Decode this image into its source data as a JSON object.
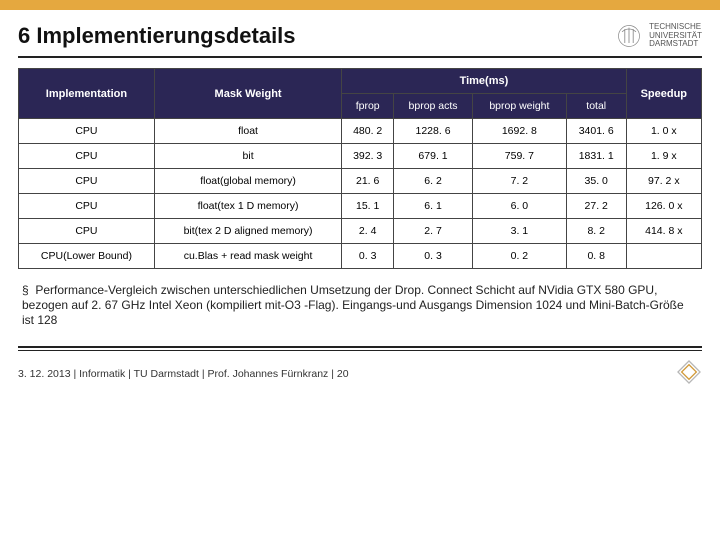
{
  "title": "6 Implementierungsdetails",
  "logo_text": [
    "TECHNISCHE",
    "UNIVERSITÄT",
    "DARMSTADT"
  ],
  "table": {
    "head1": [
      "Implementation",
      "Mask Weight",
      "Time(ms)",
      "Speedup"
    ],
    "head2": [
      "fprop",
      "bprop acts",
      "bprop weight",
      "total"
    ],
    "rows": [
      [
        "CPU",
        "float",
        "480. 2",
        "1228. 6",
        "1692. 8",
        "3401. 6",
        "1. 0 x"
      ],
      [
        "CPU",
        "bit",
        "392. 3",
        "679. 1",
        "759. 7",
        "1831. 1",
        "1. 9 x"
      ],
      [
        "CPU",
        "float(global memory)",
        "21. 6",
        "6. 2",
        "7. 2",
        "35. 0",
        "97. 2 x"
      ],
      [
        "CPU",
        "float(tex 1 D memory)",
        "15. 1",
        "6. 1",
        "6. 0",
        "27. 2",
        "126. 0 x"
      ],
      [
        "CPU",
        "bit(tex 2 D aligned memory)",
        "2. 4",
        "2. 7",
        "3. 1",
        "8. 2",
        "414. 8 x"
      ],
      [
        "CPU(Lower Bound)",
        "cu.Blas + read mask weight",
        "0. 3",
        "0. 3",
        "0. 2",
        "0. 8",
        ""
      ]
    ]
  },
  "description": "Performance-Vergleich zwischen unterschiedlichen Umsetzung der Drop. Connect Schicht auf NVidia GTX 580 GPU, bezogen auf 2. 67 GHz Intel Xeon (kompiliert mit-O3 -Flag). Eingangs-und Ausgangs Dimension 1024 und Mini-Batch-Größe ist 128",
  "footer": "3. 12. 2013  |  Informatik  |  TU Darmstadt  | Prof. Johannes Fürnkranz |  20",
  "chart_data": {
    "type": "table",
    "columns": [
      "Implementation",
      "Mask Weight",
      "fprop",
      "bprop acts",
      "bprop weight",
      "total",
      "Speedup"
    ],
    "rows": [
      [
        "CPU",
        "float",
        480.2,
        1228.6,
        1692.8,
        3401.6,
        "1.0 x"
      ],
      [
        "CPU",
        "bit",
        392.3,
        679.1,
        759.7,
        1831.1,
        "1.9 x"
      ],
      [
        "CPU",
        "float(global memory)",
        21.6,
        6.2,
        7.2,
        35.0,
        "97.2 x"
      ],
      [
        "CPU",
        "float(tex 1D memory)",
        15.1,
        6.1,
        6.0,
        27.2,
        "126.0 x"
      ],
      [
        "CPU",
        "bit(tex 2D aligned memory)",
        2.4,
        2.7,
        3.1,
        8.2,
        "414.8 x"
      ],
      [
        "CPU(Lower Bound)",
        "cu.Blas + read mask weight",
        0.3,
        0.3,
        0.2,
        0.8,
        null
      ]
    ]
  }
}
